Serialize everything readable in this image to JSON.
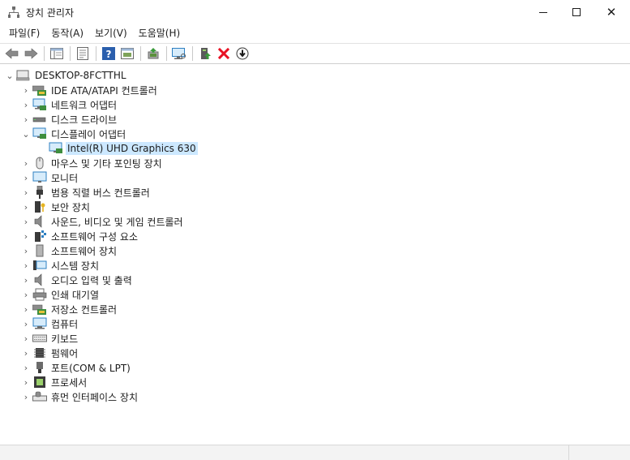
{
  "window": {
    "title": "장치 관리자",
    "controls": {
      "minimize": "—",
      "maximize": "☐",
      "close": "✕"
    }
  },
  "menu": [
    "파일(F)",
    "동작(A)",
    "보기(V)",
    "도움말(H)"
  ],
  "toolbar": [
    "back-icon",
    "forward-icon",
    "|",
    "show-hide-tree-icon",
    "|",
    "properties-icon",
    "|",
    "help-icon",
    "details-view-icon",
    "|",
    "update-driver-icon",
    "|",
    "scan-hardware-icon",
    "|",
    "add-legacy-icon",
    "uninstall-icon",
    "download-icon"
  ],
  "tree": {
    "root": "DESKTOP-8FCTTHL",
    "categories": [
      {
        "label": "IDE ATA/ATAPI 컨트롤러",
        "icon": "ide-controller-icon",
        "expanded": false
      },
      {
        "label": "네트워크 어댑터",
        "icon": "network-adapter-icon",
        "expanded": false
      },
      {
        "label": "디스크 드라이브",
        "icon": "disk-drive-icon",
        "expanded": false
      },
      {
        "label": "디스플레이 어댑터",
        "icon": "display-adapter-icon",
        "expanded": true,
        "children": [
          {
            "label": "Intel(R) UHD Graphics 630",
            "icon": "display-adapter-icon",
            "selected": true
          }
        ]
      },
      {
        "label": "마우스 및 기타 포인팅 장치",
        "icon": "mouse-icon",
        "expanded": false
      },
      {
        "label": "모니터",
        "icon": "monitor-icon",
        "expanded": false
      },
      {
        "label": "범용 직렬 버스 컨트롤러",
        "icon": "usb-icon",
        "expanded": false
      },
      {
        "label": "보안 장치",
        "icon": "security-device-icon",
        "expanded": false
      },
      {
        "label": "사운드, 비디오 및 게임 컨트롤러",
        "icon": "speaker-icon",
        "expanded": false
      },
      {
        "label": "소프트웨어 구성 요소",
        "icon": "software-component-icon",
        "expanded": false
      },
      {
        "label": "소프트웨어 장치",
        "icon": "software-device-icon",
        "expanded": false
      },
      {
        "label": "시스템 장치",
        "icon": "system-device-icon",
        "expanded": false
      },
      {
        "label": "오디오 입력 및 출력",
        "icon": "audio-io-icon",
        "expanded": false
      },
      {
        "label": "인쇄 대기열",
        "icon": "printer-icon",
        "expanded": false
      },
      {
        "label": "저장소 컨트롤러",
        "icon": "storage-controller-icon",
        "expanded": false
      },
      {
        "label": "컴퓨터",
        "icon": "computer-icon",
        "expanded": false
      },
      {
        "label": "키보드",
        "icon": "keyboard-icon",
        "expanded": false
      },
      {
        "label": "펌웨어",
        "icon": "firmware-icon",
        "expanded": false
      },
      {
        "label": "포트(COM & LPT)",
        "icon": "port-icon",
        "expanded": false
      },
      {
        "label": "프로세서",
        "icon": "processor-icon",
        "expanded": false
      },
      {
        "label": "휴먼 인터페이스 장치",
        "icon": "hid-icon",
        "expanded": false
      }
    ]
  },
  "colors": {
    "selection": "#cce8ff",
    "accent": "#0078d4",
    "uninstall": "#e81123",
    "help": "#2b5fad"
  }
}
